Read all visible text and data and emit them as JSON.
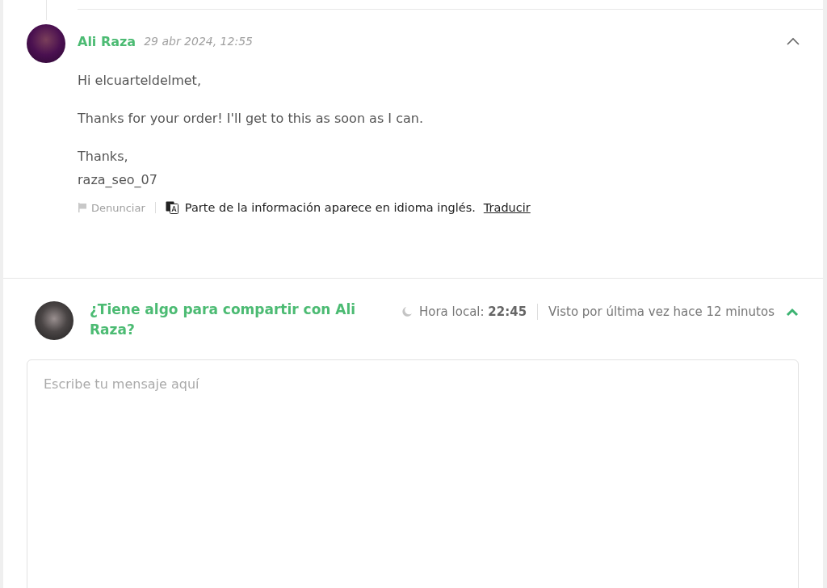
{
  "message": {
    "author": "Ali Raza",
    "date": "29 abr 2024, 12:55",
    "expanded": true,
    "paragraphs": [
      [
        "Hi elcuarteldelmet,"
      ],
      [
        "Thanks for your order! I'll get to this as soon as I can."
      ],
      [
        "Thanks,",
        "raza_seo_07"
      ]
    ],
    "report": "Denunciar",
    "translation_note": "Parte de la información aparece en idioma inglés.",
    "translate_link": "Traducir"
  },
  "composer": {
    "prompt": "¿Tiene algo para compartir con Ali Raza?",
    "local_time_label": "Hora local:",
    "local_time": "22:45",
    "last_seen": "Visto por última vez hace 12 minutos",
    "expanded": true,
    "placeholder": "Escribe tu mensaje aquí"
  }
}
